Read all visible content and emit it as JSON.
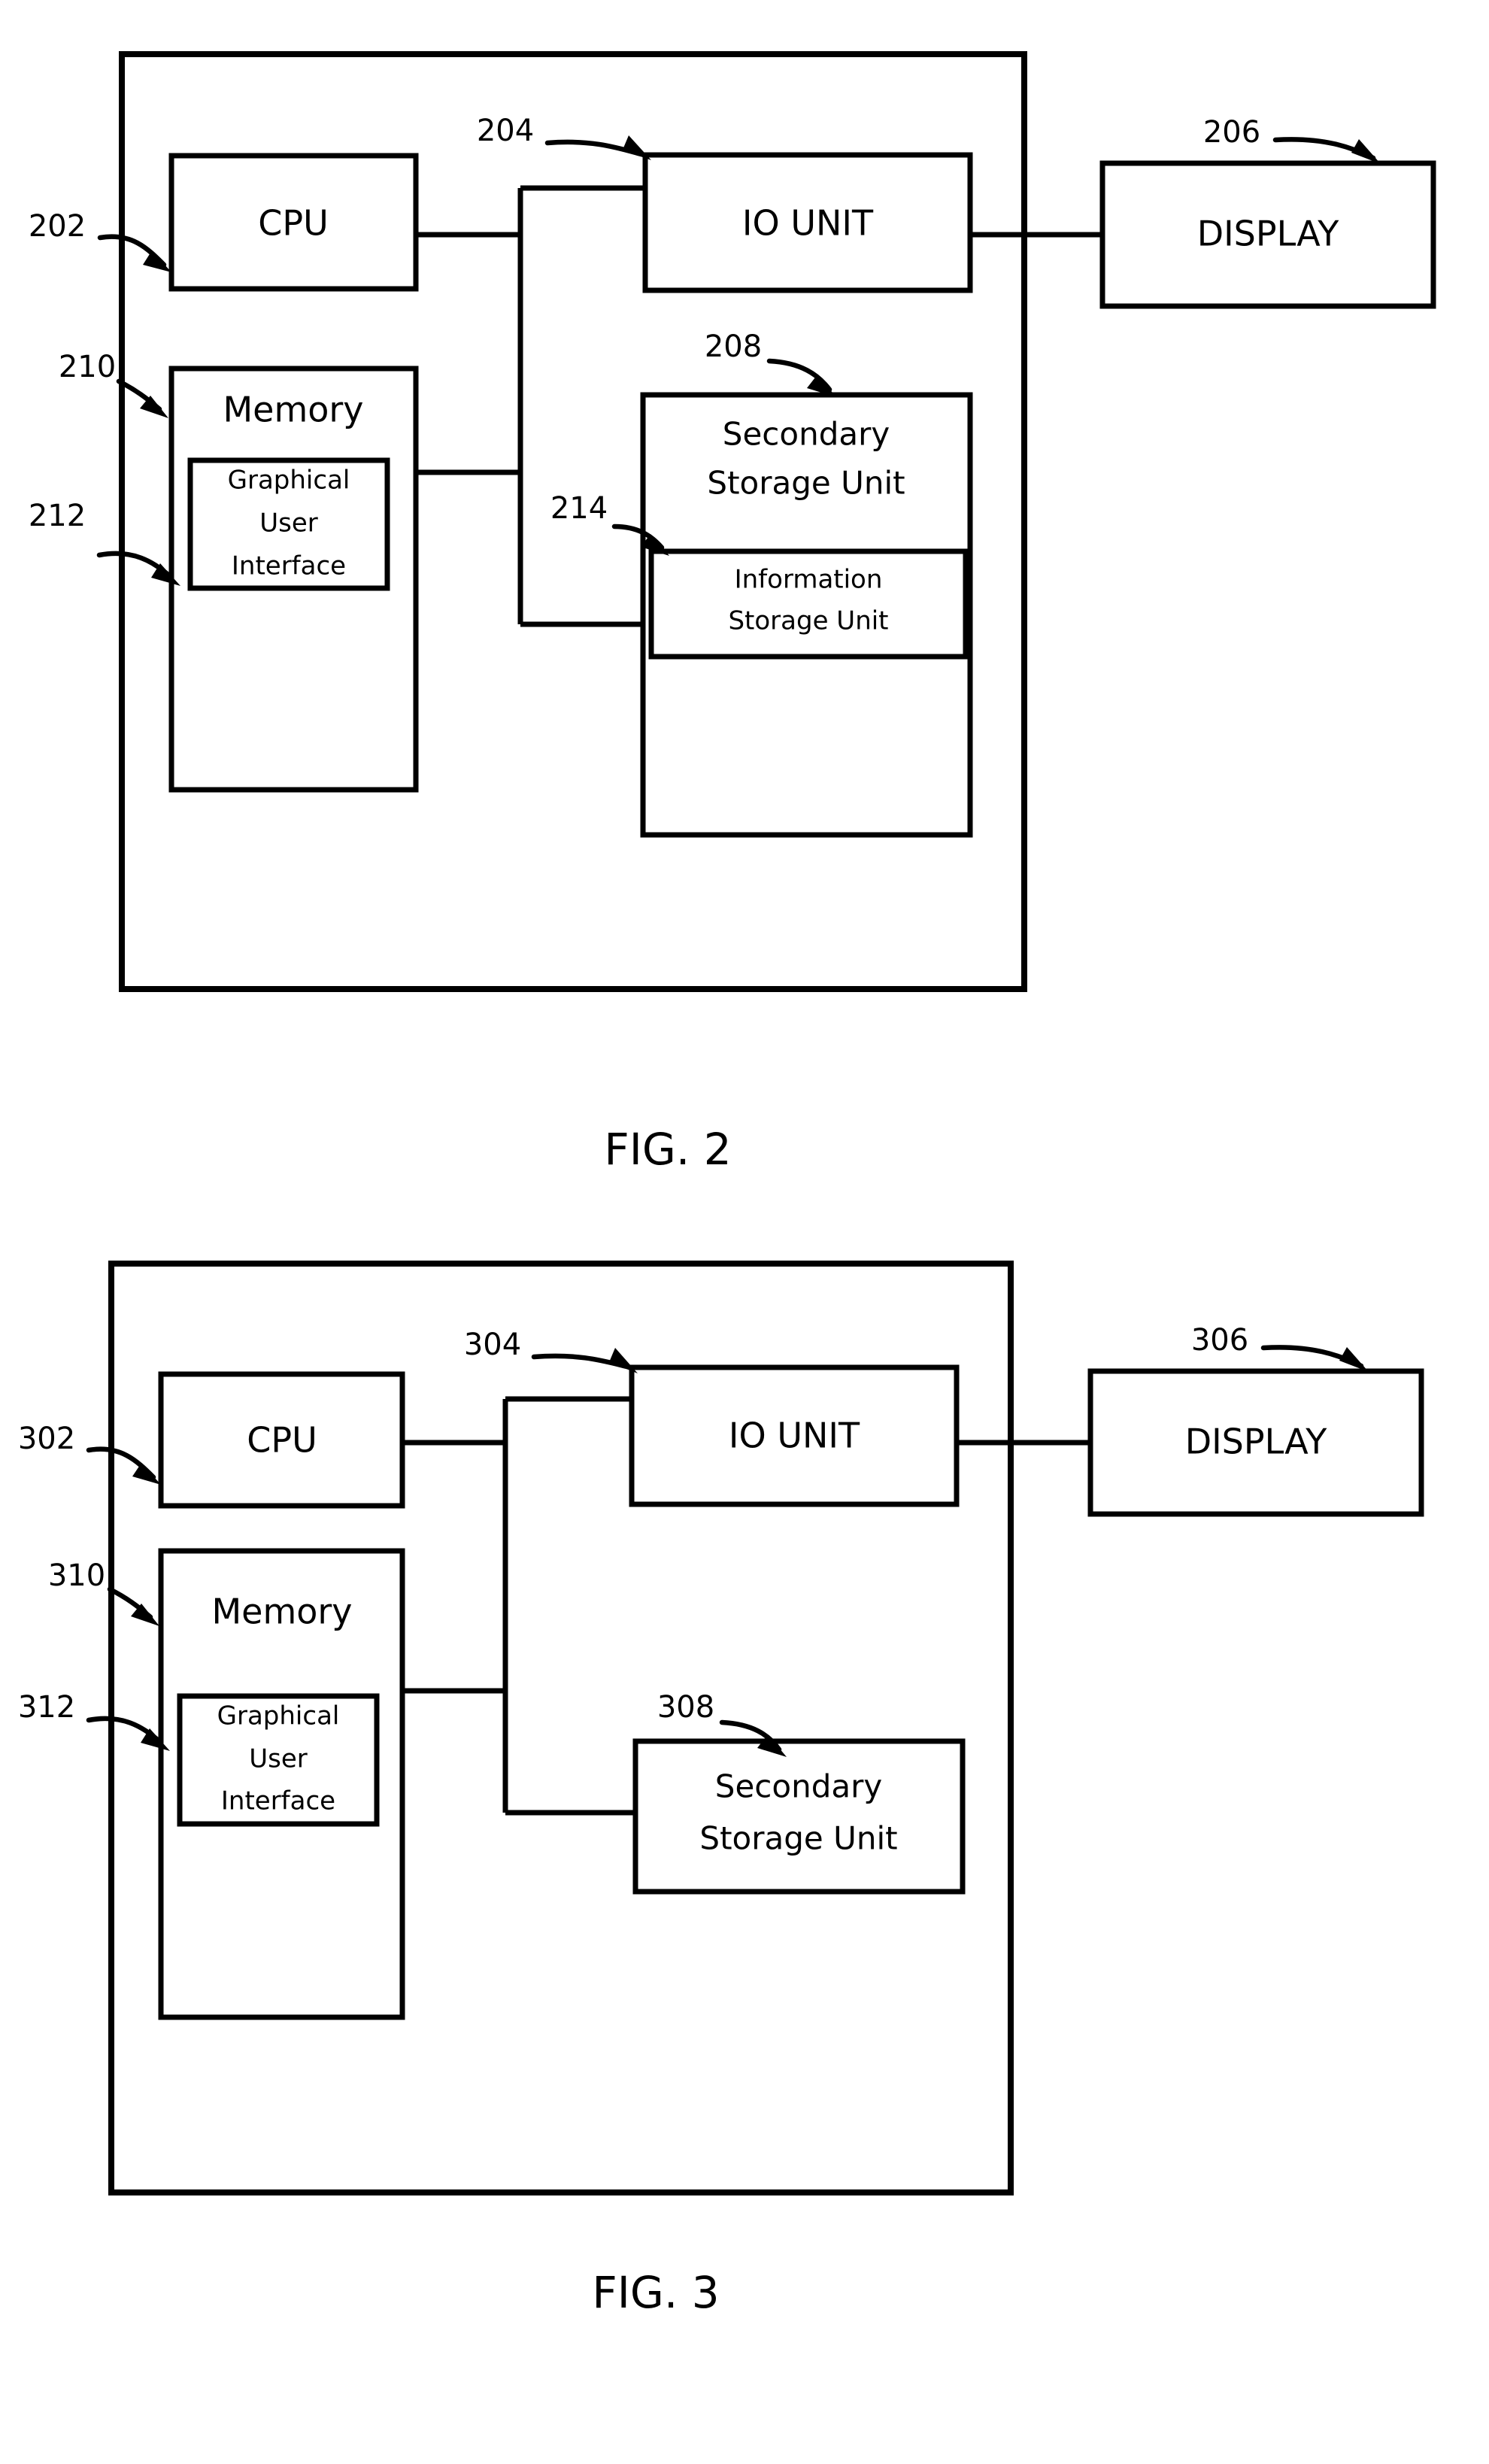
{
  "document": {
    "type": "patent-drawing-sheet",
    "background_color": "#ffffff",
    "line_color": "#000000"
  },
  "figures": [
    {
      "id": "fig-2",
      "caption": "FIG. 2",
      "boxes": [
        {
          "key": "cpu",
          "label": "CPU",
          "ref": "202"
        },
        {
          "key": "io_unit",
          "label": "IO UNIT",
          "ref": "204"
        },
        {
          "key": "display",
          "label": "DISPLAY",
          "ref": "206"
        },
        {
          "key": "memory",
          "label": "Memory",
          "ref": "210"
        },
        {
          "key": "gui",
          "label_lines": [
            "Graphical",
            "User",
            "Interface"
          ],
          "ref": "212"
        },
        {
          "key": "secondary",
          "label_lines": [
            "Secondary",
            "Storage Unit"
          ],
          "ref": "208"
        },
        {
          "key": "info",
          "label_lines": [
            "Information",
            "Storage Unit"
          ],
          "ref": "214"
        }
      ],
      "reference_numerals": [
        "202",
        "204",
        "206",
        "208",
        "210",
        "212",
        "214"
      ],
      "labels": {
        "cpu": "CPU",
        "io_unit": "IO UNIT",
        "display": "DISPLAY",
        "memory": "Memory",
        "gui_line1": "Graphical",
        "gui_line2": "User",
        "gui_line3": "Interface",
        "secondary_line1": "Secondary",
        "secondary_line2": "Storage Unit",
        "info_line1": "Information",
        "info_line2": "Storage Unit"
      },
      "refs": {
        "cpu": "202",
        "io_unit": "204",
        "display": "206",
        "secondary": "208",
        "memory": "210",
        "gui": "212",
        "info": "214"
      }
    },
    {
      "id": "fig-3",
      "caption": "FIG. 3",
      "boxes": [
        {
          "key": "cpu",
          "label": "CPU",
          "ref": "302"
        },
        {
          "key": "io_unit",
          "label": "IO UNIT",
          "ref": "304"
        },
        {
          "key": "display",
          "label": "DISPLAY",
          "ref": "306"
        },
        {
          "key": "memory",
          "label": "Memory",
          "ref": "310"
        },
        {
          "key": "gui",
          "label_lines": [
            "Graphical",
            "User",
            "Interface"
          ],
          "ref": "312"
        },
        {
          "key": "secondary",
          "label_lines": [
            "Secondary",
            "Storage Unit"
          ],
          "ref": "308"
        }
      ],
      "reference_numerals": [
        "302",
        "304",
        "306",
        "308",
        "310",
        "312"
      ],
      "labels": {
        "cpu": "CPU",
        "io_unit": "IO UNIT",
        "display": "DISPLAY",
        "memory": "Memory",
        "gui_line1": "Graphical",
        "gui_line2": "User",
        "gui_line3": "Interface",
        "secondary_line1": "Secondary",
        "secondary_line2": "Storage Unit"
      },
      "refs": {
        "cpu": "302",
        "io_unit": "304",
        "display": "306",
        "secondary": "308",
        "memory": "310",
        "gui": "312"
      }
    }
  ]
}
